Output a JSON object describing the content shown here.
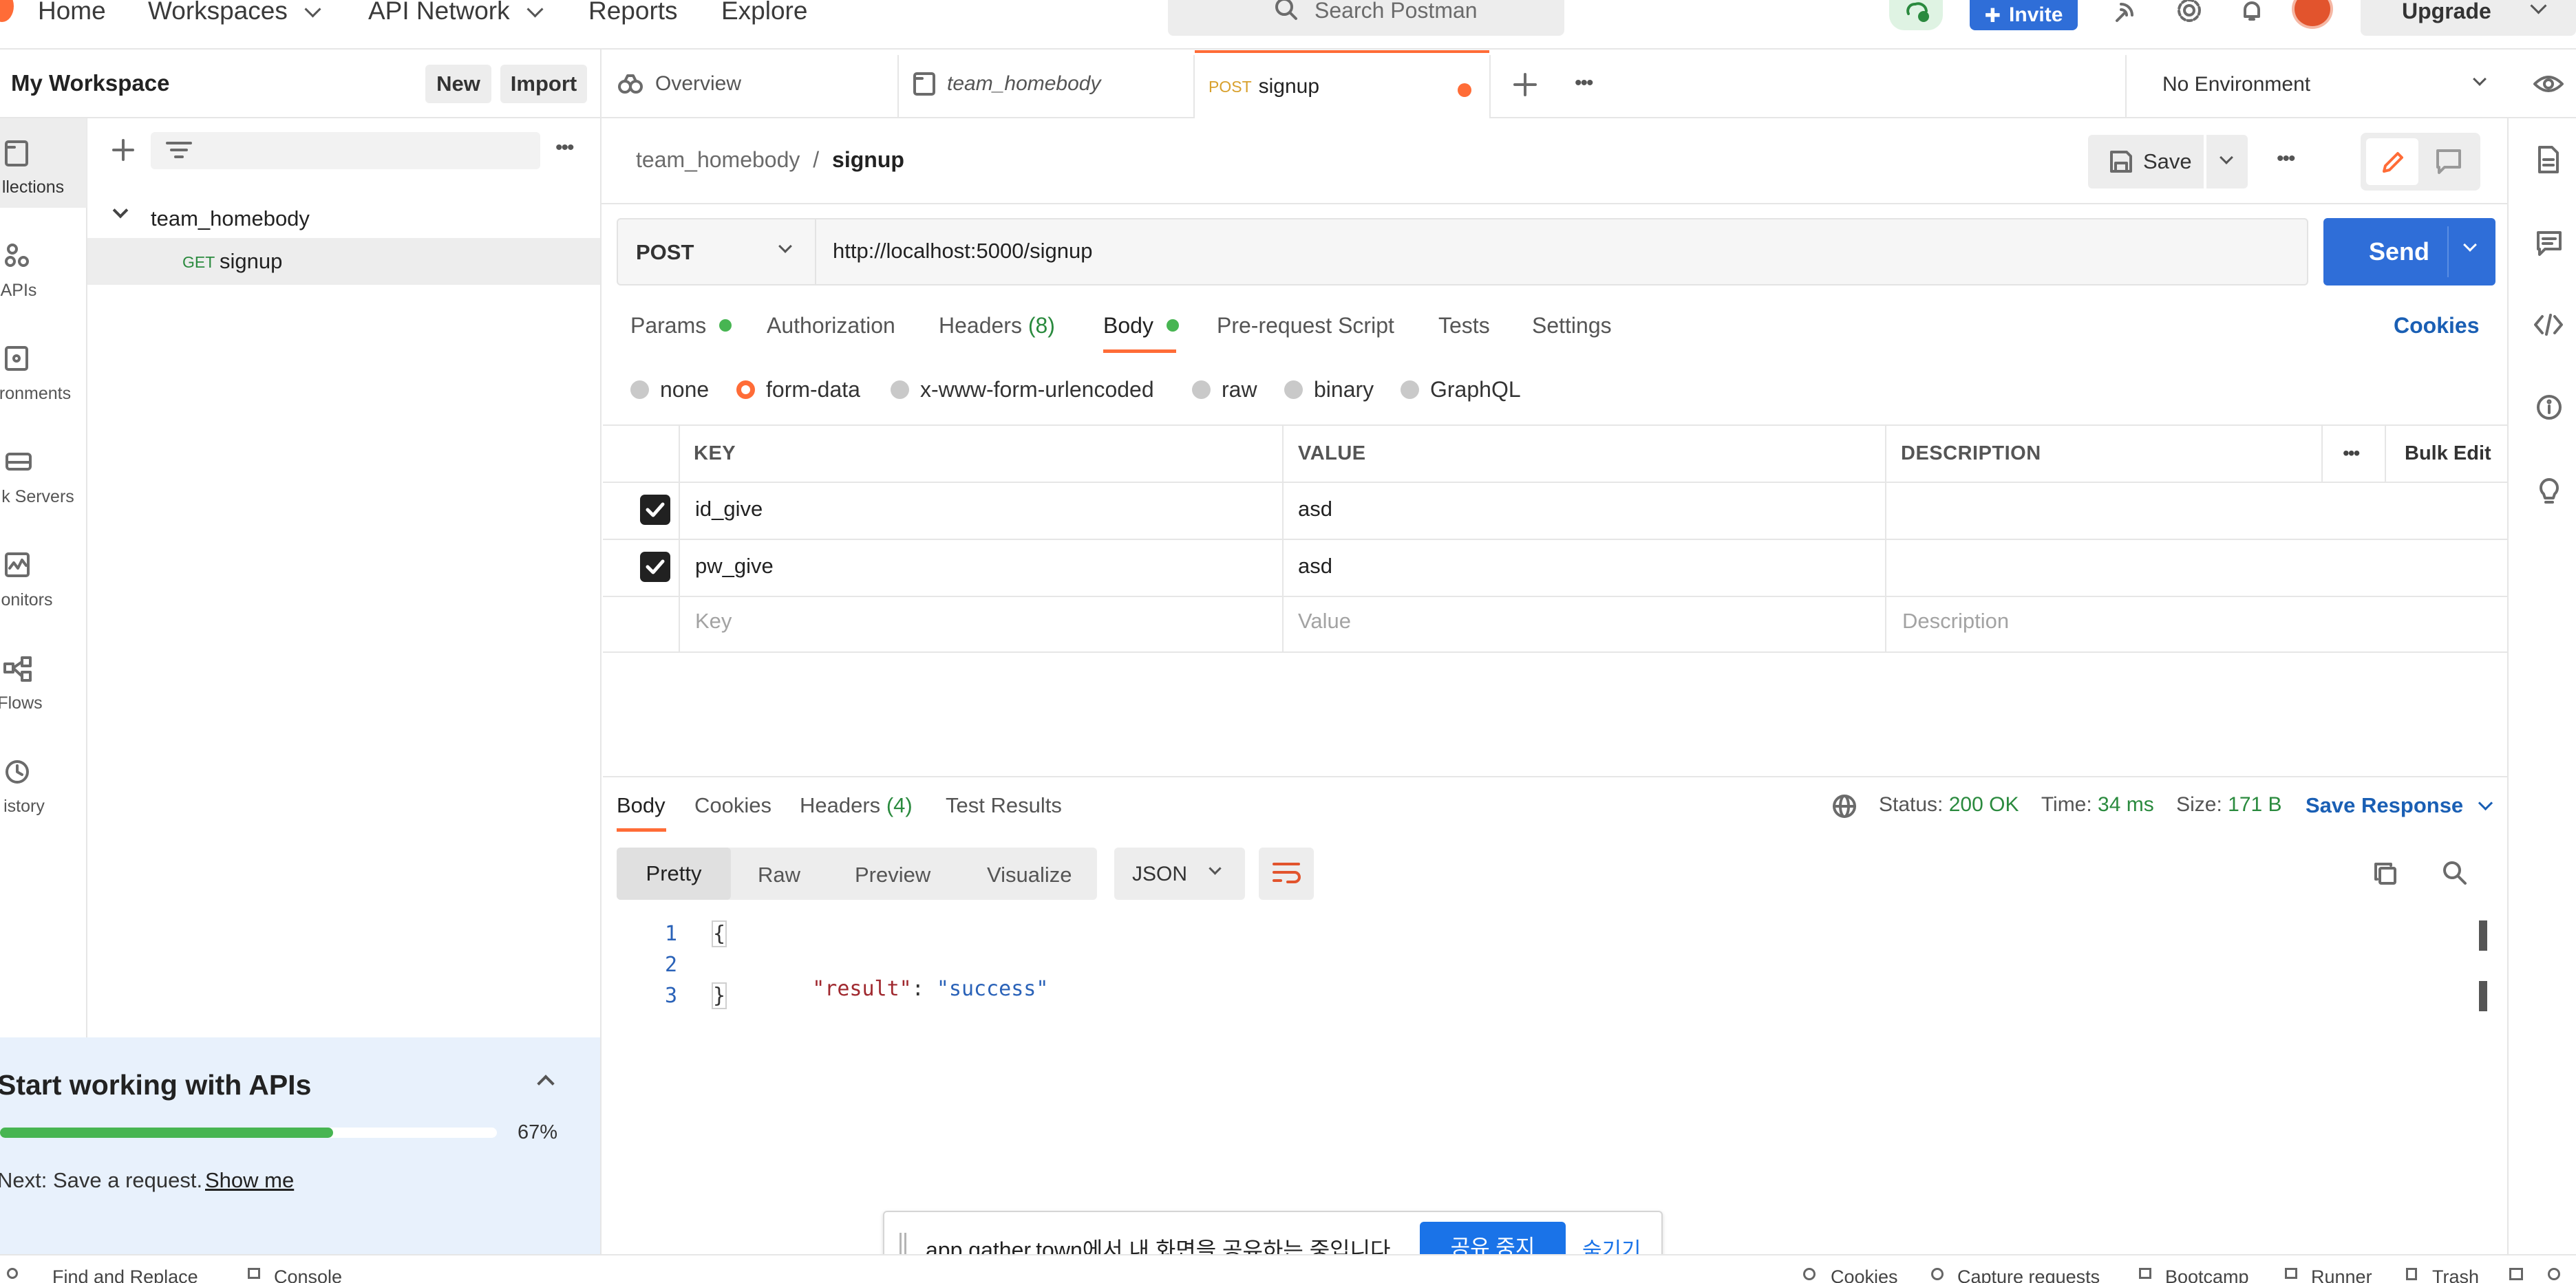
{
  "topnav": {
    "home": "Home",
    "workspaces": "Workspaces",
    "api_network": "API Network",
    "reports": "Reports",
    "explore": "Explore",
    "search_placeholder": "Search Postman",
    "invite": "Invite",
    "upgrade": "Upgrade"
  },
  "sidebar": {
    "workspace_title": "My Workspace",
    "new_label": "New",
    "import_label": "Import",
    "rail": [
      {
        "label": "llections"
      },
      {
        "label": "APIs"
      },
      {
        "label": "ronments"
      },
      {
        "label": "k Servers"
      },
      {
        "label": "onitors"
      },
      {
        "label": "Flows"
      },
      {
        "label": "istory"
      }
    ],
    "collection_name": "team_homebody",
    "request_method": "GET",
    "request_name": "signup"
  },
  "onboarding": {
    "title": "Start working with APIs",
    "progress_text": "67%",
    "progress_value": 0.67,
    "next_text": "Next: Save a request.",
    "show_me": "Show me"
  },
  "tabs": {
    "overview": "Overview",
    "collection": "team_homebody",
    "active_method": "POST",
    "active_name": "signup",
    "environment": "No Environment"
  },
  "request": {
    "breadcrumb_parent": "team_homebody",
    "breadcrumb_sep": "/",
    "breadcrumb_current": "signup",
    "save_label": "Save",
    "method": "POST",
    "url": "http://localhost:5000/signup",
    "send_label": "Send",
    "subtabs": {
      "params": "Params",
      "authorization": "Authorization",
      "headers": "Headers",
      "headers_count": "(8)",
      "body": "Body",
      "prerequest": "Pre-request Script",
      "tests": "Tests",
      "settings": "Settings",
      "cookies": "Cookies"
    },
    "body_types": {
      "none": "none",
      "form_data": "form-data",
      "urlencoded": "x-www-form-urlencoded",
      "raw": "raw",
      "binary": "binary",
      "graphql": "GraphQL"
    },
    "table": {
      "key_header": "KEY",
      "value_header": "VALUE",
      "description_header": "DESCRIPTION",
      "bulk_edit": "Bulk Edit",
      "rows": [
        {
          "key": "id_give",
          "value": "asd"
        },
        {
          "key": "pw_give",
          "value": "asd"
        }
      ],
      "key_placeholder": "Key",
      "value_placeholder": "Value",
      "description_placeholder": "Description"
    }
  },
  "response": {
    "tabs": {
      "body": "Body",
      "cookies": "Cookies",
      "headers": "Headers",
      "headers_count": "(4)",
      "test_results": "Test Results"
    },
    "status_label": "Status:",
    "status_value": "200 OK",
    "time_label": "Time:",
    "time_value": "34 ms",
    "size_label": "Size:",
    "size_value": "171 B",
    "save_response": "Save Response",
    "view_modes": {
      "pretty": "Pretty",
      "raw": "Raw",
      "preview": "Preview",
      "visualize": "Visualize"
    },
    "format": "JSON",
    "lines": [
      {
        "n": "1",
        "text": "{"
      },
      {
        "n": "2",
        "key": "\"result\"",
        "colon": ": ",
        "value": "\"success\""
      },
      {
        "n": "3",
        "text": "}"
      }
    ]
  },
  "share_banner": {
    "text": "app.gather.town에서 내 화면을 공유하는 중입니다.",
    "stop_label": "공유 중지",
    "hide_label": "숨기기"
  },
  "statusbar": {
    "find_replace": "Find and Replace",
    "console": "Console",
    "cookies": "Cookies",
    "capture": "Capture requests",
    "bootcamp": "Bootcamp",
    "runner": "Runner",
    "trash": "Trash"
  },
  "colors": {
    "accent_orange": "#ff6c37",
    "send_blue": "#2f6ed8",
    "link_blue": "#1a5fb4",
    "status_green": "#2a8a3e",
    "progress_green": "#47b552"
  }
}
